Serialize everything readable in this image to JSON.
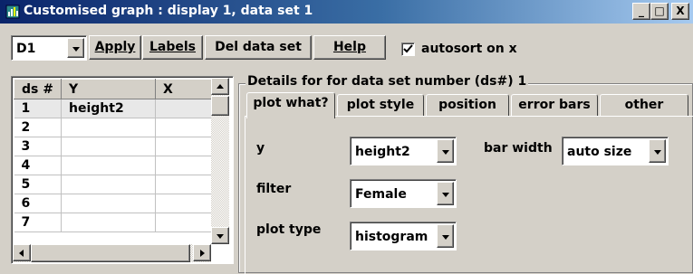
{
  "window": {
    "title": "Customised graph : display 1, data set 1",
    "controls": [
      "_",
      "□",
      "X"
    ]
  },
  "toolbar": {
    "dataset_select": "D1",
    "apply_label": "Apply",
    "labels_label": "Labels",
    "del_label": "Del data set",
    "help_label": "Help",
    "autosort_label": "autosort on x",
    "autosort_checked": true
  },
  "grid": {
    "columns": [
      "ds #",
      "Y",
      "X"
    ],
    "rows": [
      {
        "ds": "1",
        "y": "height2",
        "x": ""
      },
      {
        "ds": "2",
        "y": "",
        "x": ""
      },
      {
        "ds": "3",
        "y": "",
        "x": ""
      },
      {
        "ds": "4",
        "y": "",
        "x": ""
      },
      {
        "ds": "5",
        "y": "",
        "x": ""
      },
      {
        "ds": "6",
        "y": "",
        "x": ""
      },
      {
        "ds": "7",
        "y": "",
        "x": ""
      }
    ]
  },
  "details": {
    "title": "Details for for data set number (ds#) 1",
    "tabs": [
      "plot what?",
      "plot style",
      "position",
      "error bars",
      "other"
    ],
    "active_tab": "plot what?",
    "y_label": "y",
    "y_value": "height2",
    "filter_label": "filter",
    "filter_value": "Female",
    "plot_type_label": "plot type",
    "plot_type_value": "histogram",
    "bar_width_label": "bar width",
    "bar_width_value": "auto size"
  }
}
